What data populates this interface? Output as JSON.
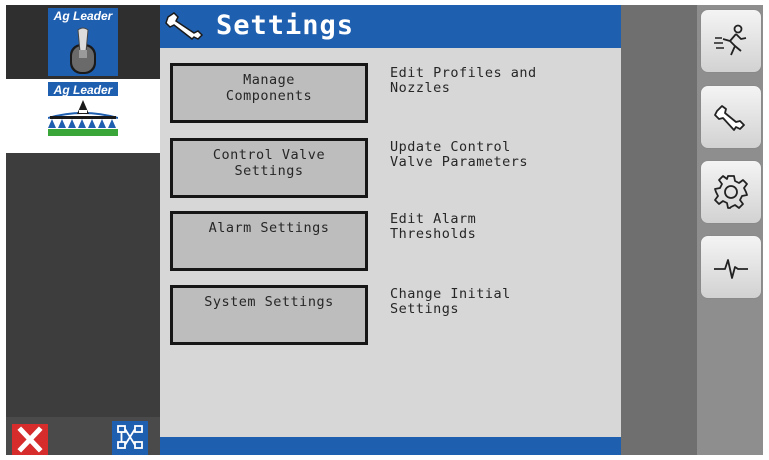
{
  "left_panel": {
    "modules": [
      {
        "brand": "Ag Leader",
        "icon": "toggle-switch-icon"
      },
      {
        "brand": "Ag Leader",
        "icon": "sprayer-icon"
      }
    ],
    "close_icon": "close-icon",
    "network_icon": "network-icon"
  },
  "header": {
    "title": "Settings",
    "icon": "wrench-icon"
  },
  "settings": [
    {
      "button": "Manage\nComponents",
      "description": "Edit Profiles and\nNozzles"
    },
    {
      "button": "Control Valve\nSettings",
      "description": "Update Control\nValve Parameters"
    },
    {
      "button": "Alarm Settings",
      "description": "Edit Alarm\nThresholds"
    },
    {
      "button": "System Settings",
      "description": "Change Initial\nSettings"
    }
  ],
  "side_menu": [
    "running-person-icon",
    "wrench-icon",
    "gear-icon",
    "pulse-icon"
  ],
  "colors": {
    "title_bar": "#1f5fb0",
    "panel_bg": "#d7d7d7",
    "button_bg": "#bdbdbd",
    "close": "#d62c2c"
  }
}
